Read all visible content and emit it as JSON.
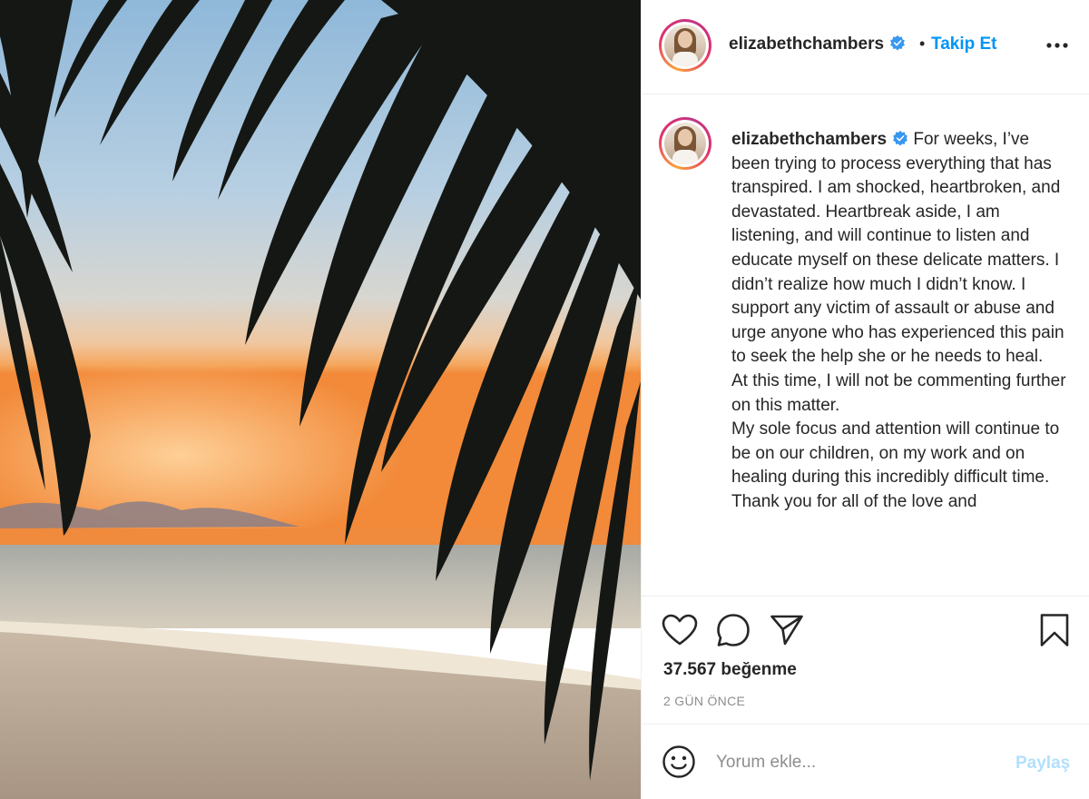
{
  "post": {
    "username": "elizabethchambers",
    "verified": true,
    "dot": "•",
    "follow_label": "Takip Et",
    "caption": {
      "username": "elizabethchambers",
      "text": "For weeks, I’ve been trying to process everything that has transpired. I am shocked, heartbroken, and devastated. Heartbreak aside, I am listening, and will continue to listen and educate myself on these delicate matters. I didn’t realize how much I didn’t know. I support any victim of assault or abuse and urge anyone who has experienced this pain to seek the help she or he needs to heal.\nAt this time, I will not be commenting further on this matter.\nMy sole focus and attention will continue to be on our children, on my work and on healing during this incredibly difficult time.\nThank you for all of the love and"
    },
    "likes_label": "37.567 beğenme",
    "time_ago": "2 GÜN ÖNCE",
    "comment_placeholder": "Yorum ekle...",
    "share_label": "Paylaş"
  },
  "icons": {
    "verified": "verified-badge-icon",
    "more": "more-options-icon",
    "like": "heart-icon",
    "comment": "comment-bubble-icon",
    "share": "paper-plane-icon",
    "save": "bookmark-icon",
    "emoji": "emoji-smiley-icon"
  },
  "colors": {
    "link_blue": "#0095f6",
    "verified_blue": "#3897f0",
    "disabled_blue": "#b2dffc",
    "secondary_text": "#8e8e8e",
    "divider": "#efefef"
  }
}
